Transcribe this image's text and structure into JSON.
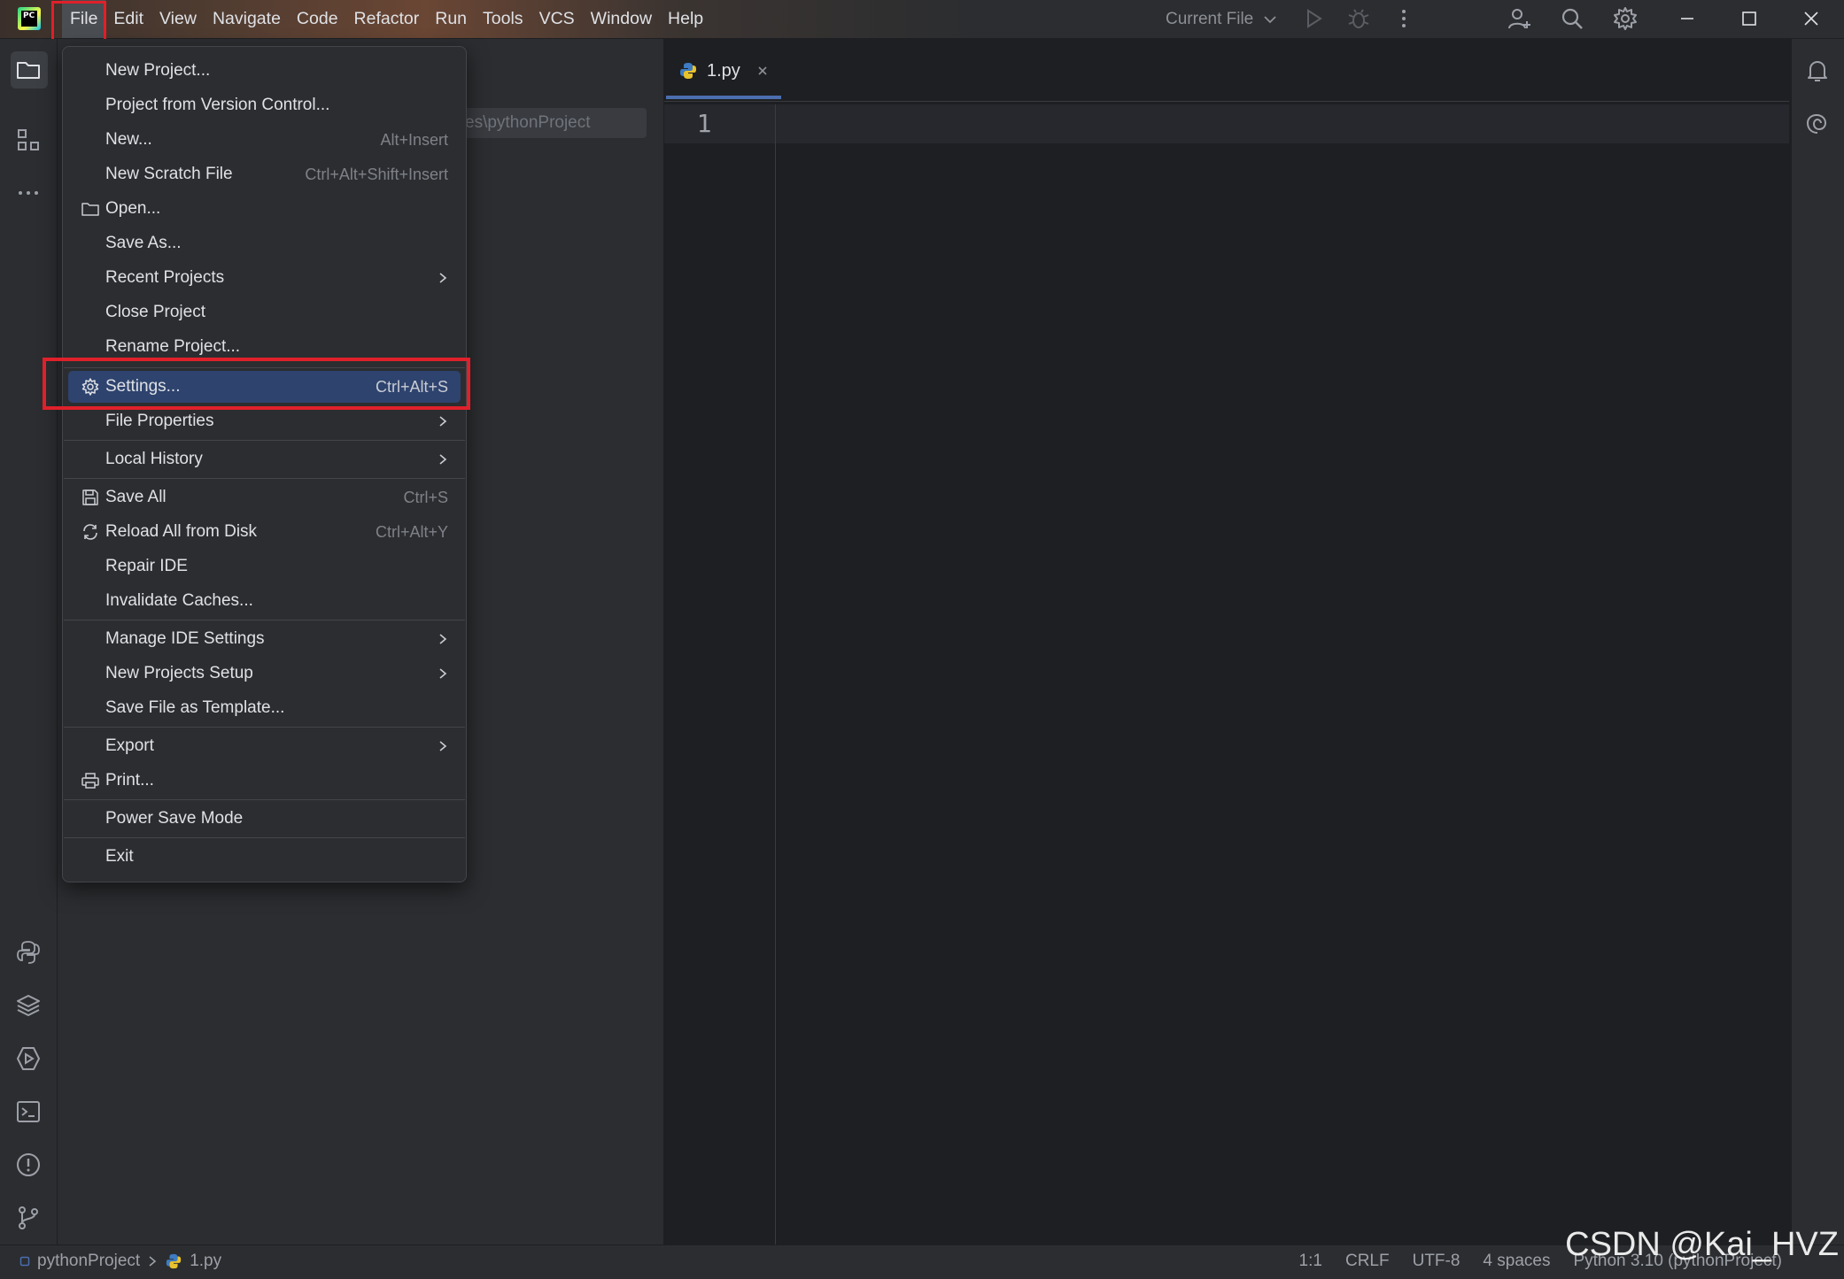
{
  "menubar": {
    "items": [
      "File",
      "Edit",
      "View",
      "Navigate",
      "Code",
      "Refactor",
      "Run",
      "Tools",
      "VCS",
      "Window",
      "Help"
    ],
    "active_index": 0
  },
  "toolbar": {
    "run_config": "Current File"
  },
  "project_panel": {
    "path_field": "es\\pythonProject"
  },
  "editor": {
    "tab_label": "1.py",
    "line_numbers": [
      "1"
    ]
  },
  "file_menu": {
    "items": [
      {
        "label": "New Project...",
        "shortcut": "",
        "submenu": false,
        "icon": ""
      },
      {
        "label": "Project from Version Control...",
        "shortcut": "",
        "submenu": false,
        "icon": ""
      },
      {
        "label": "New...",
        "shortcut": "Alt+Insert",
        "submenu": false,
        "icon": ""
      },
      {
        "label": "New Scratch File",
        "shortcut": "Ctrl+Alt+Shift+Insert",
        "submenu": false,
        "icon": ""
      },
      {
        "label": "Open...",
        "shortcut": "",
        "submenu": false,
        "icon": "folder-icon"
      },
      {
        "label": "Save As...",
        "shortcut": "",
        "submenu": false,
        "icon": ""
      },
      {
        "label": "Recent Projects",
        "shortcut": "",
        "submenu": true,
        "icon": ""
      },
      {
        "label": "Close Project",
        "shortcut": "",
        "submenu": false,
        "icon": ""
      },
      {
        "label": "Rename Project...",
        "shortcut": "",
        "submenu": false,
        "icon": ""
      },
      {
        "label": "Settings...",
        "shortcut": "Ctrl+Alt+S",
        "submenu": false,
        "icon": "gear-icon",
        "selected": true
      },
      {
        "label": "File Properties",
        "shortcut": "",
        "submenu": true,
        "icon": ""
      },
      {
        "label": "Local History",
        "shortcut": "",
        "submenu": true,
        "icon": ""
      },
      {
        "label": "Save All",
        "shortcut": "Ctrl+S",
        "submenu": false,
        "icon": "save-icon"
      },
      {
        "label": "Reload All from Disk",
        "shortcut": "Ctrl+Alt+Y",
        "submenu": false,
        "icon": "reload-icon"
      },
      {
        "label": "Repair IDE",
        "shortcut": "",
        "submenu": false,
        "icon": ""
      },
      {
        "label": "Invalidate Caches...",
        "shortcut": "",
        "submenu": false,
        "icon": ""
      },
      {
        "label": "Manage IDE Settings",
        "shortcut": "",
        "submenu": true,
        "icon": ""
      },
      {
        "label": "New Projects Setup",
        "shortcut": "",
        "submenu": true,
        "icon": ""
      },
      {
        "label": "Save File as Template...",
        "shortcut": "",
        "submenu": false,
        "icon": ""
      },
      {
        "label": "Export",
        "shortcut": "",
        "submenu": true,
        "icon": ""
      },
      {
        "label": "Print...",
        "shortcut": "",
        "submenu": false,
        "icon": "print-icon"
      },
      {
        "label": "Power Save Mode",
        "shortcut": "",
        "submenu": false,
        "icon": ""
      },
      {
        "label": "Exit",
        "shortcut": "",
        "submenu": false,
        "icon": ""
      }
    ]
  },
  "statusbar": {
    "breadcrumb_project": "pythonProject",
    "breadcrumb_file": "1.py",
    "position": "1:1",
    "line_separator": "CRLF",
    "encoding": "UTF-8",
    "indent": "4 spaces",
    "interpreter": "Python 3.10 (pythonProject)"
  },
  "watermark": "CSDN @Kai_HVZ",
  "colors": {
    "accent": "#2e436e",
    "highlight_box": "#e0202a",
    "background": "#1e1f22",
    "panel": "#2b2d30"
  }
}
